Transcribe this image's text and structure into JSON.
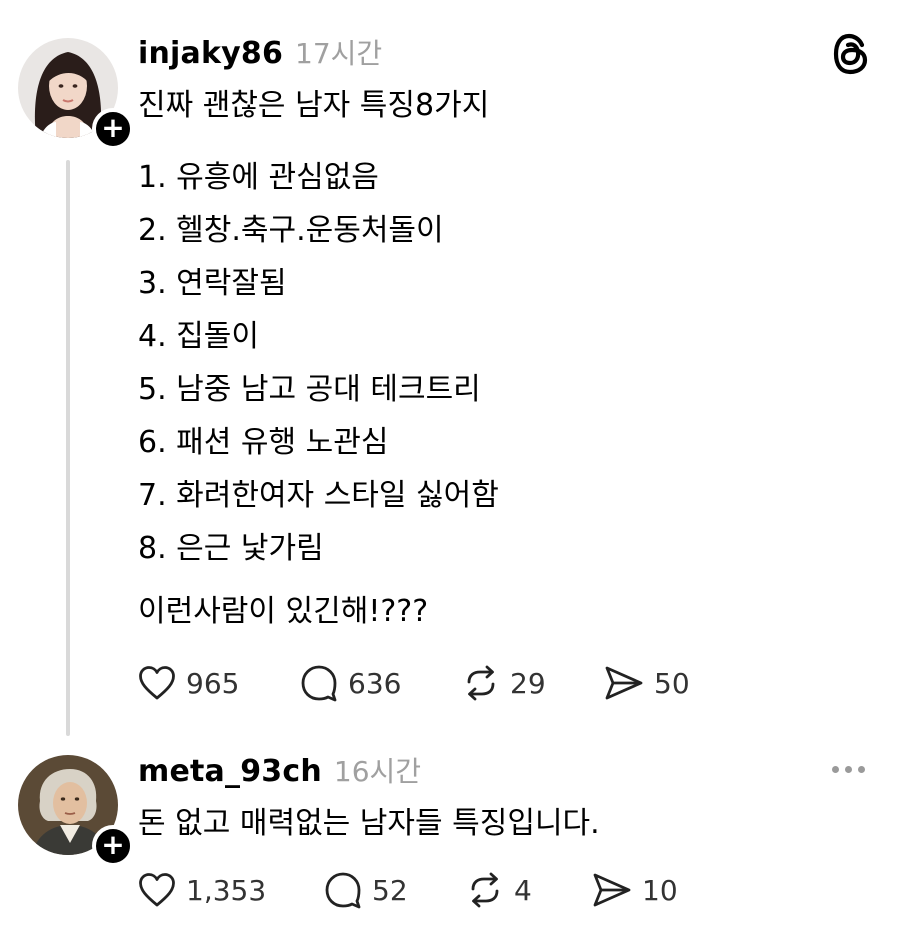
{
  "post": {
    "username": "injaky86",
    "timestamp": "17시간",
    "title": "진짜 괜찮은 남자 특징8가지",
    "items": [
      "1. 유흥에 관심없음",
      "2. 헬창.축구.운동처돌이",
      "3. 연락잘됨",
      "4. 집돌이",
      "5. 남중 남고 공대 테크트리",
      "6. 패션 유행 노관심",
      "7. 화려한여자 스타일 싫어함",
      "8. 은근 낯가림"
    ],
    "closing": "이런사람이 있긴해!???",
    "likes": "965",
    "comments": "636",
    "reposts": "29",
    "shares": "50",
    "follow_glyph": "+",
    "logo_icon": "threads-logo-icon"
  },
  "reply": {
    "username": "meta_93ch",
    "timestamp": "16시간",
    "text": "돈 없고 매력없는 남자들 특징입니다.",
    "likes": "1,353",
    "comments": "52",
    "reposts": "4",
    "shares": "10",
    "follow_glyph": "+",
    "more_icon": "more-options-icon"
  },
  "icons": {
    "like": "heart-icon",
    "comment": "comment-bubble-icon",
    "repost": "repost-icon",
    "share": "send-icon"
  },
  "colors": {
    "text": "#000000",
    "muted": "#a0a0a0",
    "thread_line": "#d9d9d9"
  }
}
